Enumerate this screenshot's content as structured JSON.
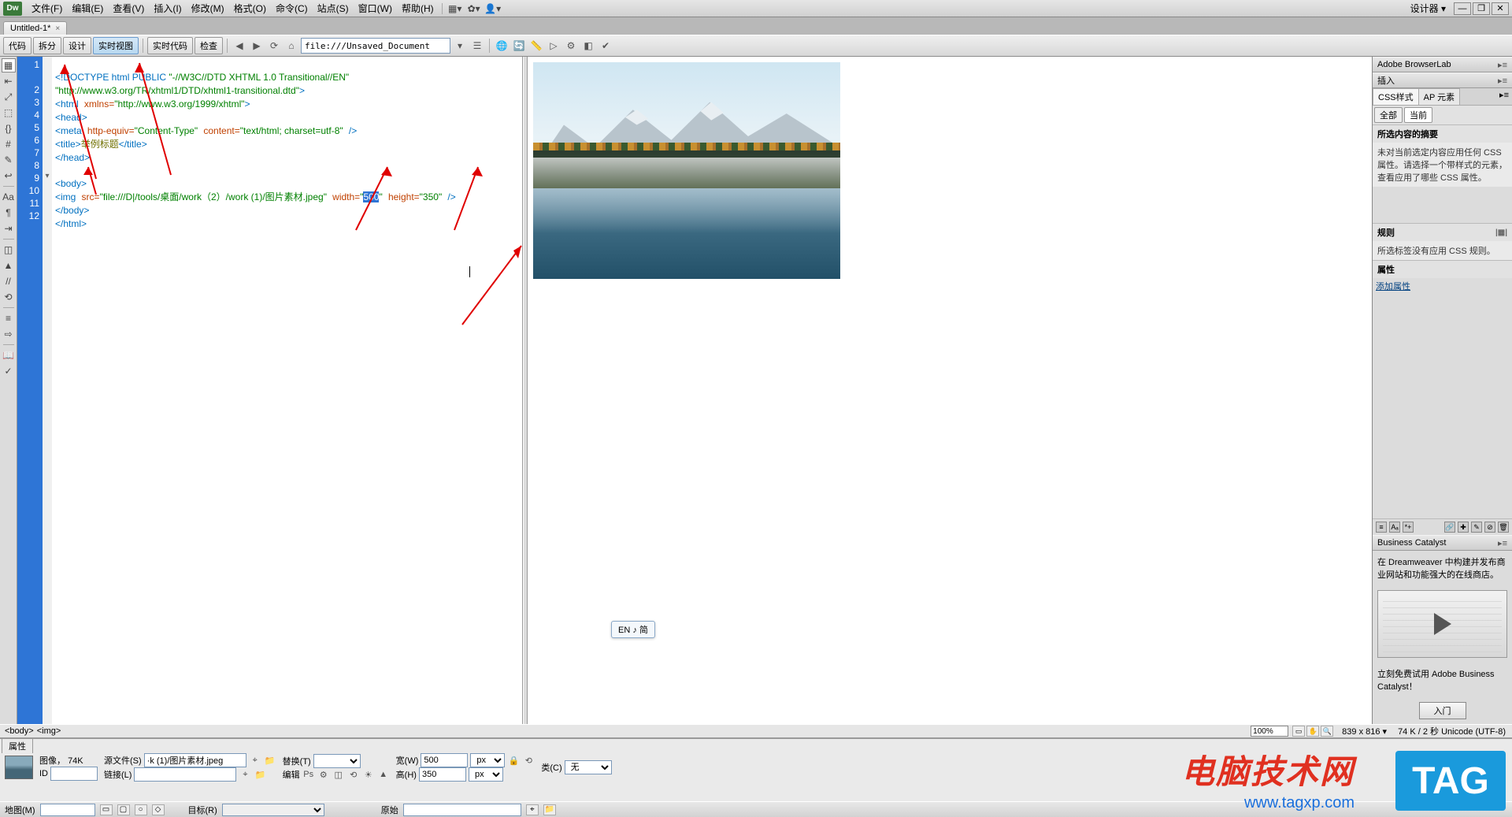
{
  "menubar": {
    "logo": "Dw",
    "items": [
      "文件(F)",
      "编辑(E)",
      "查看(V)",
      "插入(I)",
      "修改(M)",
      "格式(O)",
      "命令(C)",
      "站点(S)",
      "窗口(W)",
      "帮助(H)"
    ],
    "right_label": "设计器",
    "dropdown_glyph": "▾"
  },
  "doctab": {
    "title": "Untitled-1*",
    "close": "×"
  },
  "toolbar": {
    "views": {
      "code": "代码",
      "split": "拆分",
      "design": "设计",
      "live": "实时视图"
    },
    "live_code": "实时代码",
    "inspect": "检查",
    "address": "file:///Unsaved_Document"
  },
  "code": {
    "lines": [
      {
        "n": 1,
        "raw": "<!DOCTYPE html PUBLIC \"-//W3C//DTD XHTML 1.0 Transitional//EN\""
      },
      {
        "n": 1,
        "cont": "\"http://www.w3.org/TR/xhtml1/DTD/xhtml1-transitional.dtd\">"
      },
      {
        "n": 2,
        "raw": "<html xmlns=\"http://www.w3.org/1999/xhtml\">"
      },
      {
        "n": 3,
        "raw": "<head>"
      },
      {
        "n": 4,
        "raw": "<meta http-equiv=\"Content-Type\" content=\"text/html; charset=utf-8\" />"
      },
      {
        "n": 5,
        "raw": "<title>举例标题</title>"
      },
      {
        "n": 6,
        "raw": "</head>"
      },
      {
        "n": 7,
        "raw": ""
      },
      {
        "n": 8,
        "raw": "<body>"
      },
      {
        "n": 9,
        "raw": "<img src=\"file:///D|/tools/桌面/work（2）/work (1)/图片素材.jpeg\" width=\"500\" height=\"350\" />"
      },
      {
        "n": 10,
        "raw": "</body>"
      },
      {
        "n": 11,
        "raw": "</html>"
      },
      {
        "n": 12,
        "raw": ""
      }
    ],
    "selected_value": "500",
    "height_value": "350",
    "title_text": "举例标题",
    "img_path": "file:///D|/tools/桌面/work（2）/work (1)/图片素材.jpeg"
  },
  "tagbar": {
    "crumbs": [
      "<body>",
      "<img>"
    ],
    "zoom": "100%",
    "dims": "839 x 816",
    "status": "74 K / 2 秒 Unicode (UTF-8)"
  },
  "panels": {
    "browserlab": "Adobe BrowserLab",
    "insert": "插入",
    "css_tab": "CSS样式",
    "ap_tab": "AP 元素",
    "all": "全部",
    "current": "当前",
    "summary_title": "所选内容的摘要",
    "summary_text": "未对当前选定内容应用任何 CSS 属性。请选择一个带样式的元素，查看应用了哪些 CSS 属性。",
    "rules_title": "规则",
    "rules_text": "所选标签没有应用 CSS 规则。",
    "props_title": "属性",
    "add_prop": "添加属性",
    "bc_title": "Business Catalyst",
    "bc_text": "在 Dreamweaver 中构建并发布商业网站和功能强大的在线商店。",
    "bc_cta": "立刻免费试用 Adobe Business Catalyst！",
    "bc_btn": "入门"
  },
  "props": {
    "tab": "属性",
    "image_label": "图像，",
    "image_size": "74K",
    "src_label": "源文件(S)",
    "src_value": "·k (1)/图片素材.jpeg",
    "alt_label": "替换(T)",
    "alt_value": "",
    "w_label": "宽(W)",
    "w_value": "500",
    "h_label": "高(H)",
    "h_value": "350",
    "px": "px",
    "class_label": "类(C)",
    "class_value": "无",
    "id_label": "ID",
    "id_value": "",
    "link_label": "链接(L)",
    "link_value": "",
    "edit_label": "编辑",
    "map_label": "地图(M)",
    "target_label": "目标(R)",
    "orig_label": "原始"
  },
  "ime": "EN ♪ 简",
  "watermark1": "电脑技术网",
  "watermark2": "www.tagxp.com",
  "taglogo": "TAG"
}
